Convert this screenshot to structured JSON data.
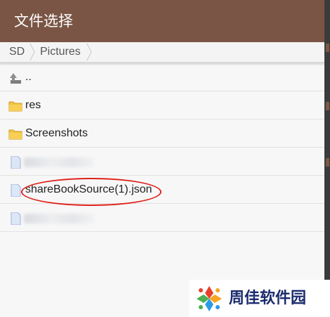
{
  "dialog": {
    "title": "文件选择"
  },
  "breadcrumb": {
    "items": [
      {
        "label": "SD"
      },
      {
        "label": "Pictures"
      }
    ]
  },
  "files": [
    {
      "name": "..",
      "icon": "parent-folder-icon",
      "type": "parent"
    },
    {
      "name": "res",
      "icon": "folder-icon",
      "type": "folder"
    },
    {
      "name": "Screenshots",
      "icon": "folder-icon",
      "type": "folder"
    },
    {
      "name": "",
      "icon": "file-icon",
      "type": "file",
      "obscured": true
    },
    {
      "name": "shareBookSource(1).json",
      "icon": "file-icon",
      "type": "file",
      "highlighted": true
    },
    {
      "name": "",
      "icon": "file-icon",
      "type": "file",
      "obscured": true
    }
  ],
  "watermark": {
    "text": "周佳软件园"
  },
  "colors": {
    "title_bar": "#7a5546",
    "annotation_circle": "#e0201a",
    "folder": "#f5c542",
    "file_icon": "#dde6f7"
  }
}
